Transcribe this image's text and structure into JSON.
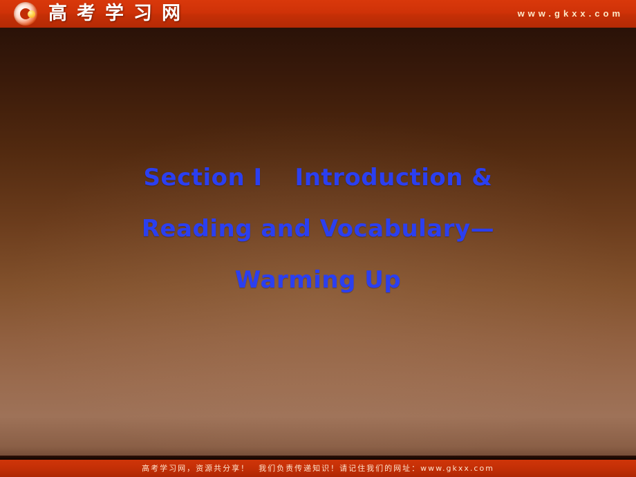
{
  "header": {
    "logo_icon": "gkxx-circle-logo-icon",
    "site_name": "高考学习网",
    "site_url": "www.gkxx.com"
  },
  "slide": {
    "title_lines": [
      "Section Ⅰ  Introduction &",
      "Reading and Vocabulary—",
      "Warming Up"
    ],
    "title_color": "#2b3ff0",
    "background_color": "#8a5b3d"
  },
  "footer": {
    "text": "高考学习网，资源共分享！　我们负责传递知识！请记住我们的网址：www.gkxx.com"
  }
}
